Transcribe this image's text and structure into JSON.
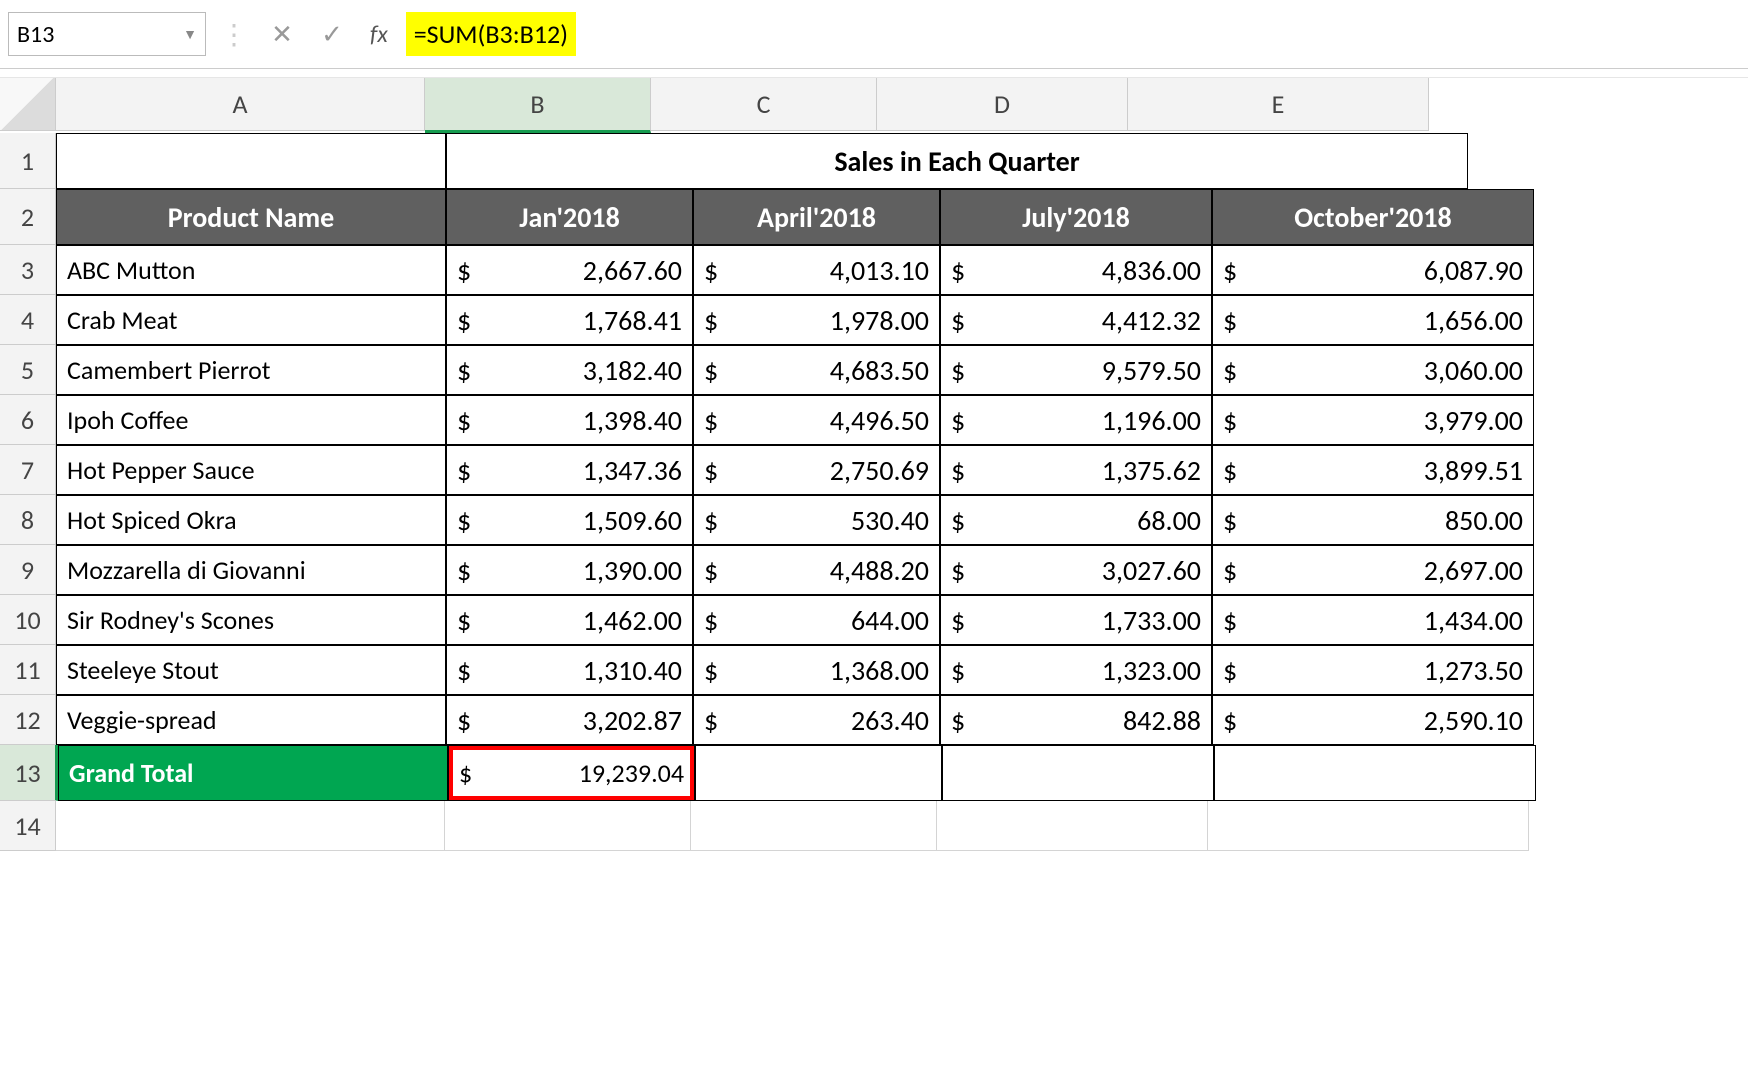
{
  "formula_bar": {
    "cell_ref": "B13",
    "cancel_icon": "✕",
    "confirm_icon": "✓",
    "fx_label": "fx",
    "formula": "=SUM(B3:B12)"
  },
  "columns": [
    "A",
    "B",
    "C",
    "D",
    "E"
  ],
  "rows": [
    "1",
    "2",
    "3",
    "4",
    "5",
    "6",
    "7",
    "8",
    "9",
    "10",
    "11",
    "12",
    "13",
    "14"
  ],
  "selected_cell": {
    "col": "B",
    "row": "13"
  },
  "merged_title": "Sales in Each Quarter",
  "table_headers": {
    "product": "Product Name",
    "q1": "Jan'2018",
    "q2": "April'2018",
    "q3": "July'2018",
    "q4": "October'2018"
  },
  "products": [
    {
      "name": "ABC Mutton",
      "q1": "2,667.60",
      "q2": "4,013.10",
      "q3": "4,836.00",
      "q4": "6,087.90"
    },
    {
      "name": "Crab Meat",
      "q1": "1,768.41",
      "q2": "1,978.00",
      "q3": "4,412.32",
      "q4": "1,656.00"
    },
    {
      "name": "Camembert Pierrot",
      "q1": "3,182.40",
      "q2": "4,683.50",
      "q3": "9,579.50",
      "q4": "3,060.00"
    },
    {
      "name": "Ipoh Coffee",
      "q1": "1,398.40",
      "q2": "4,496.50",
      "q3": "1,196.00",
      "q4": "3,979.00"
    },
    {
      "name": "Hot Pepper Sauce",
      "q1": "1,347.36",
      "q2": "2,750.69",
      "q3": "1,375.62",
      "q4": "3,899.51"
    },
    {
      "name": " Hot Spiced Okra",
      "q1": "1,509.60",
      "q2": "530.40",
      "q3": "68.00",
      "q4": "850.00"
    },
    {
      "name": "Mozzarella di Giovanni",
      "q1": "1,390.00",
      "q2": "4,488.20",
      "q3": "3,027.60",
      "q4": "2,697.00"
    },
    {
      "name": "Sir Rodney's Scones",
      "q1": "1,462.00",
      "q2": "644.00",
      "q3": "1,733.00",
      "q4": "1,434.00"
    },
    {
      "name": "Steeleye Stout",
      "q1": "1,310.40",
      "q2": "1,368.00",
      "q3": "1,323.00",
      "q4": "1,273.50"
    },
    {
      "name": "Veggie-spread",
      "q1": "3,202.87",
      "q2": "263.40",
      "q3": "842.88",
      "q4": "2,590.10"
    }
  ],
  "grand_total": {
    "label": "Grand Total",
    "value": "19,239.04"
  },
  "currency_sign": "$",
  "chart_data": {
    "type": "table",
    "title": "Sales in Each Quarter",
    "columns": [
      "Product Name",
      "Jan'2018",
      "April'2018",
      "July'2018",
      "October'2018"
    ],
    "rows": [
      [
        "ABC Mutton",
        2667.6,
        4013.1,
        4836.0,
        6087.9
      ],
      [
        "Crab Meat",
        1768.41,
        1978.0,
        4412.32,
        1656.0
      ],
      [
        "Camembert Pierrot",
        3182.4,
        4683.5,
        9579.5,
        3060.0
      ],
      [
        "Ipoh Coffee",
        1398.4,
        4496.5,
        1196.0,
        3979.0
      ],
      [
        "Hot Pepper Sauce",
        1347.36,
        2750.69,
        1375.62,
        3899.51
      ],
      [
        "Hot Spiced Okra",
        1509.6,
        530.4,
        68.0,
        850.0
      ],
      [
        "Mozzarella di Giovanni",
        1390.0,
        4488.2,
        3027.6,
        2697.0
      ],
      [
        "Sir Rodney's Scones",
        1462.0,
        644.0,
        1733.0,
        1434.0
      ],
      [
        "Steeleye Stout",
        1310.4,
        1368.0,
        1323.0,
        1273.5
      ],
      [
        "Veggie-spread",
        3202.87,
        263.4,
        842.88,
        2590.1
      ]
    ],
    "totals": {
      "Jan'2018": 19239.04
    }
  }
}
